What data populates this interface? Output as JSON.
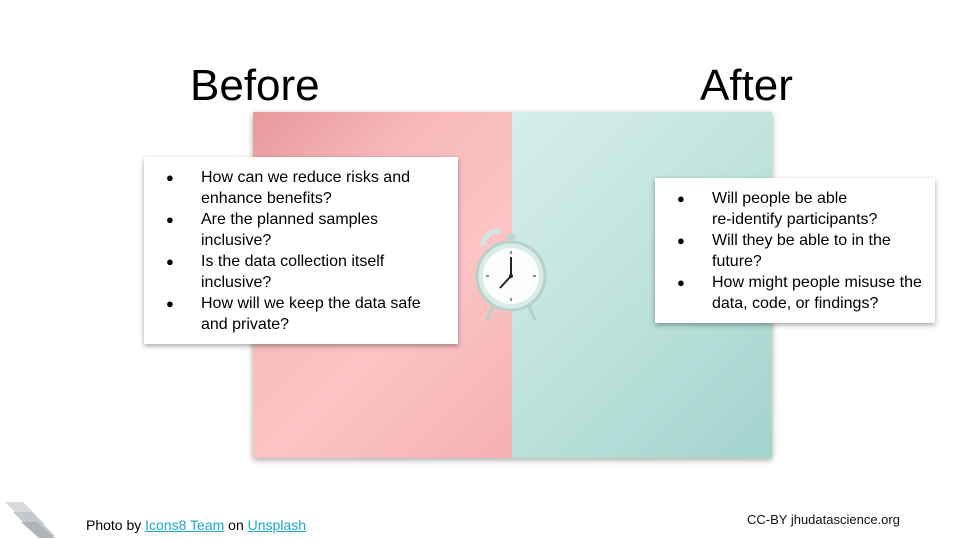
{
  "slide": {
    "before_title": "Before",
    "after_title": "After",
    "before_items": [
      "How can we reduce risks and enhance benefits?",
      "Are the planned samples inclusive?",
      "Is the data collection itself inclusive?",
      "How will we keep the data safe and private?"
    ],
    "after_items": [
      "Will people be able\nre-identify participants?",
      "Will they be able to in the future?",
      "How might people misuse the data, code, or findings?"
    ],
    "bullet": "●"
  },
  "footer": {
    "photo_prefix": "Photo by ",
    "photographer": "Icons8 Team",
    "on_text": " on ",
    "platform": "Unsplash",
    "license": "CC-BY jhudatascience.org"
  },
  "colors": {
    "link": "#1aa6c7",
    "pink_panel": "#fcc4c4",
    "mint_panel": "#c6e6e0"
  },
  "icons": {
    "photo_subject": "alarm-clock-icon",
    "brand_mark": "logo-stripes-icon"
  }
}
